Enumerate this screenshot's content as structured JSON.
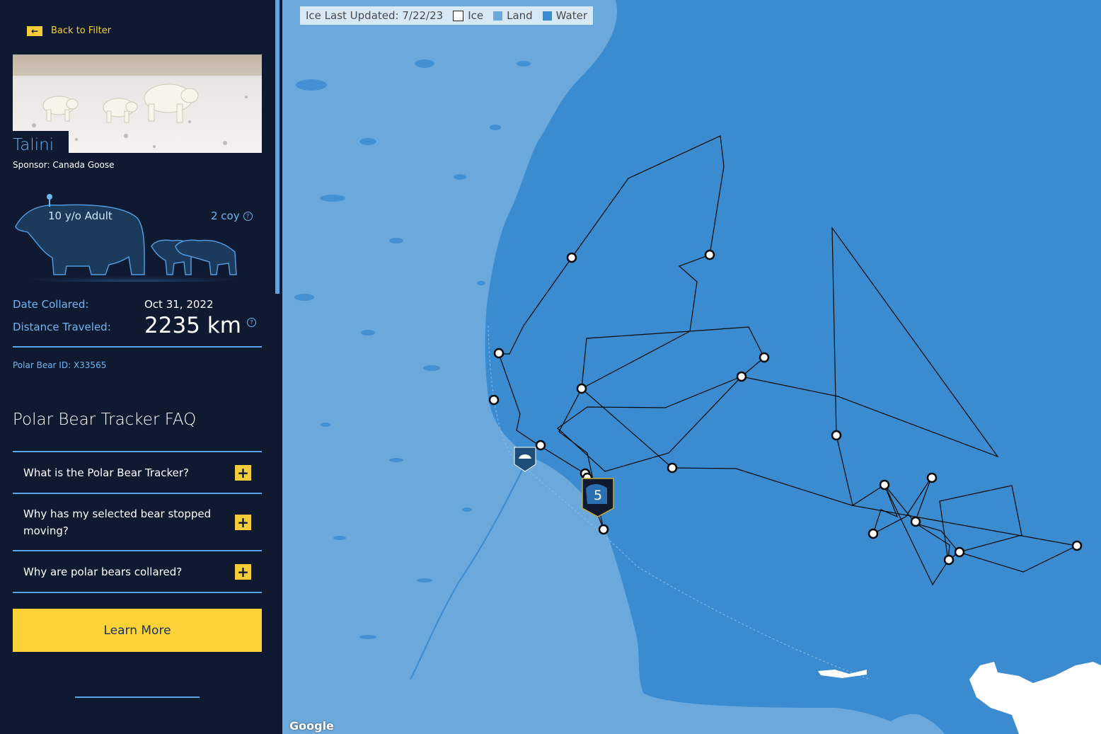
{
  "sidebar": {
    "back_label": "Back to Filter",
    "bear_name": "Talini",
    "sponsor": "Sponsor: Canada Goose",
    "age_label": "10 y/o Adult",
    "coy_label": "2 coy",
    "date_collared_label": "Date Collared:",
    "date_collared_value": "Oct 31, 2022",
    "distance_label": "Distance Traveled:",
    "distance_value": "2235 km",
    "bear_id": "Polar Bear ID: X33565",
    "faq_title": "Polar Bear Tracker FAQ",
    "faq_items": [
      {
        "question": "What is the Polar Bear Tracker?",
        "icon": "+"
      },
      {
        "question": "Why has my selected bear stopped moving?",
        "icon": "+"
      },
      {
        "question": "Why are polar bears collared?",
        "icon": "+"
      }
    ],
    "learn_more_label": "Learn More"
  },
  "map": {
    "legend": {
      "title": "Ice Last Updated: 7/22/23",
      "items": [
        {
          "label": "Ice",
          "color": "#ffffff"
        },
        {
          "label": "Land",
          "color": "#6ba9dc"
        },
        {
          "label": "Water",
          "color": "#3a8bcf"
        }
      ]
    },
    "cluster_count": "5",
    "attribution": "Google"
  },
  "colors": {
    "sidebar_bg": "#0f1a30",
    "accent_blue": "#6eb5f2",
    "accent_yellow": "#fdd138",
    "land": "#6ba9dc",
    "water": "#3a8bcf"
  }
}
